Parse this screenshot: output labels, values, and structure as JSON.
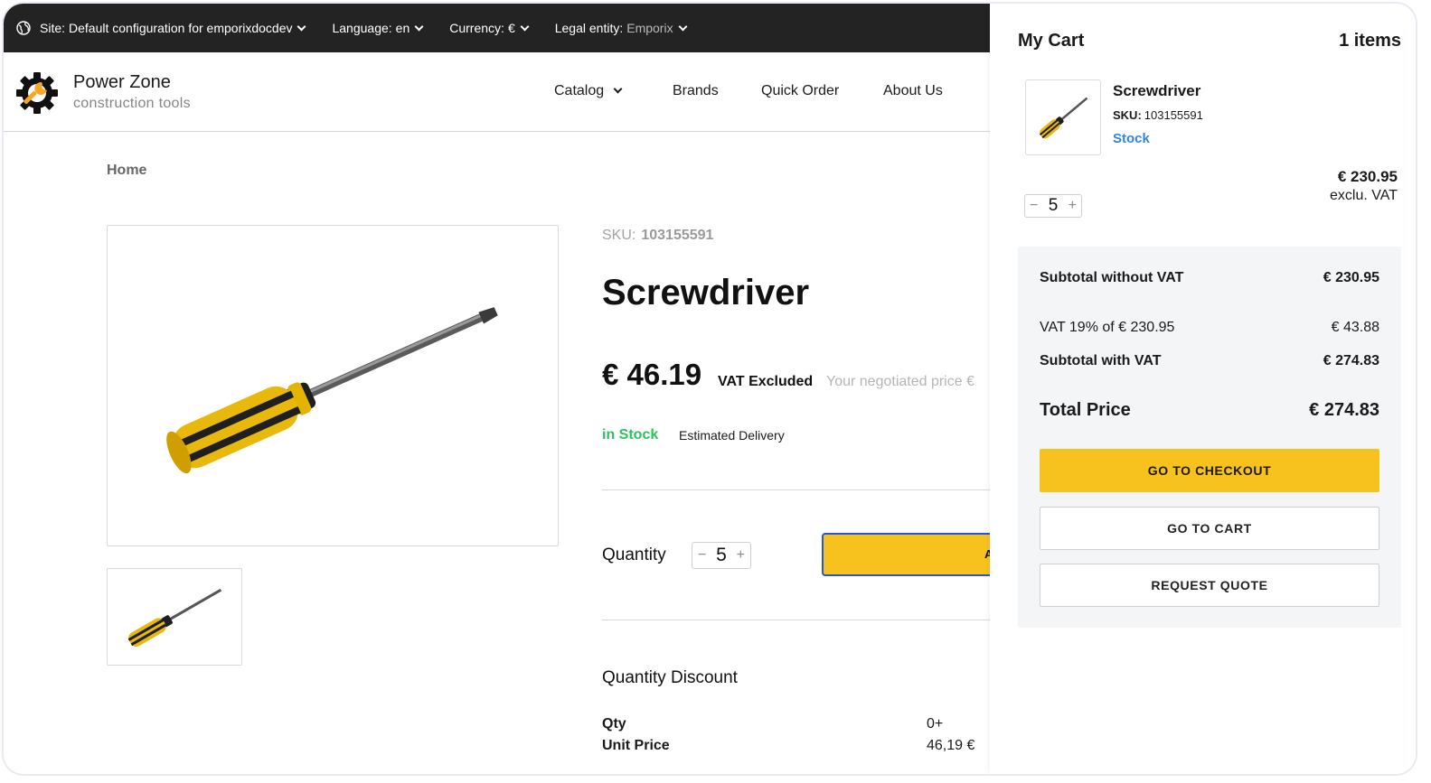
{
  "topbar": {
    "site_label": "Site:",
    "site_value": "Default configuration for emporixdocdev",
    "language_label": "Language:",
    "language_value": "en",
    "currency_label": "Currency:",
    "currency_value": "€",
    "legal_label": "Legal entity:",
    "legal_value": "Emporix"
  },
  "header": {
    "brand_name": "Power Zone",
    "brand_sub": "construction tools",
    "nav": [
      "Catalog",
      "Brands",
      "Quick Order",
      "About Us"
    ]
  },
  "breadcrumb": "Home",
  "product": {
    "sku_label": "SKU:",
    "sku": "103155591",
    "title": "Screwdriver",
    "price": "€ 46.19",
    "vat_note": "VAT Excluded",
    "negotiated": "Your negotiated price €",
    "stock": "in Stock",
    "delivery": "Estimated Delivery",
    "quantity_label": "Quantity",
    "quantity": "5",
    "add_button": "A",
    "qd_title": "Quantity Discount",
    "qd_qty_label": "Qty",
    "qd_qty_value": "0+",
    "qd_unit_label": "Unit Price",
    "qd_unit_value": "46,19 €"
  },
  "cart": {
    "title": "My Cart",
    "count": "1 items",
    "item": {
      "name": "Screwdriver",
      "sku_label": "SKU:",
      "sku": "103155591",
      "stock": "Stock",
      "price": "€ 230.95",
      "vat_note": "exclu. VAT",
      "quantity": "5"
    },
    "subtotal_wo_vat_label": "Subtotal without VAT",
    "subtotal_wo_vat": "€ 230.95",
    "vat_label": "VAT 19% of € 230.95",
    "vat": "€ 43.88",
    "subtotal_w_vat_label": "Subtotal with VAT",
    "subtotal_w_vat": "€ 274.83",
    "total_label": "Total Price",
    "total": "€ 274.83",
    "checkout_button": "GO TO CHECKOUT",
    "cart_button": "GO TO CART",
    "quote_button": "REQUEST QUOTE"
  },
  "colors": {
    "accent_yellow": "#f8c21e",
    "topbar_bg": "#232323",
    "stock_green": "#2ec05e",
    "link_blue": "#2f86d8",
    "focus_blue": "#2457d6"
  }
}
